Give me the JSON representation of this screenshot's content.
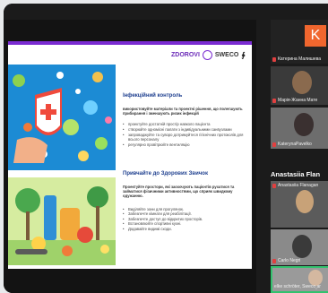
{
  "slide": {
    "logo_text": "ZDOROVI",
    "logo_partner": "SWECO",
    "logo_mark": "∳",
    "section1": {
      "title": "Інфекційний контроль",
      "lead": "використовуйте матеріали та проектні рішення, що полегшують прибирання і зменшують ризик інфекцій",
      "bullets": [
        "проектуйте достатній простір навколо пацієнта",
        "створюйте одномісні палати з індивідуальними санвузлами",
        "запроваджуйте та суворо дотримуйтеся гігієнічних протоколів для всього персоналу",
        "регулярно провітрюйте вентиляцію"
      ]
    },
    "section2": {
      "title": "Привчайте до Здорових Звичок",
      "lead": "Проектуйте простори, які заохочують пацієнтів рухатися та займатися фізичними активностями, що сприяє швидкому одужанню.",
      "bullets": [
        "Виділяйте зони для прогулянок.",
        "Забезпечте кімнати для реабілітації.",
        "Забезпечте доступ до відкритих просторів.",
        "Встановлюйте спортивні кухні.",
        "Додавайте видимі сходи."
      ]
    }
  },
  "participants": [
    {
      "name": "Катерина Малишева",
      "initial": "K",
      "avatar_color": "#f0662e"
    },
    {
      "name": "Марія-Жанна Мате"
    },
    {
      "name": "KaterynaPavelko"
    },
    {
      "name": "Anastasiia Flan"
    },
    {
      "name": "Anastasiia Flanagan"
    },
    {
      "name": "Carlo Negri"
    },
    {
      "name": "elke schröter, Sweco ar"
    }
  ],
  "panel": {
    "scroll_down_icon": "chevron-down-icon"
  }
}
